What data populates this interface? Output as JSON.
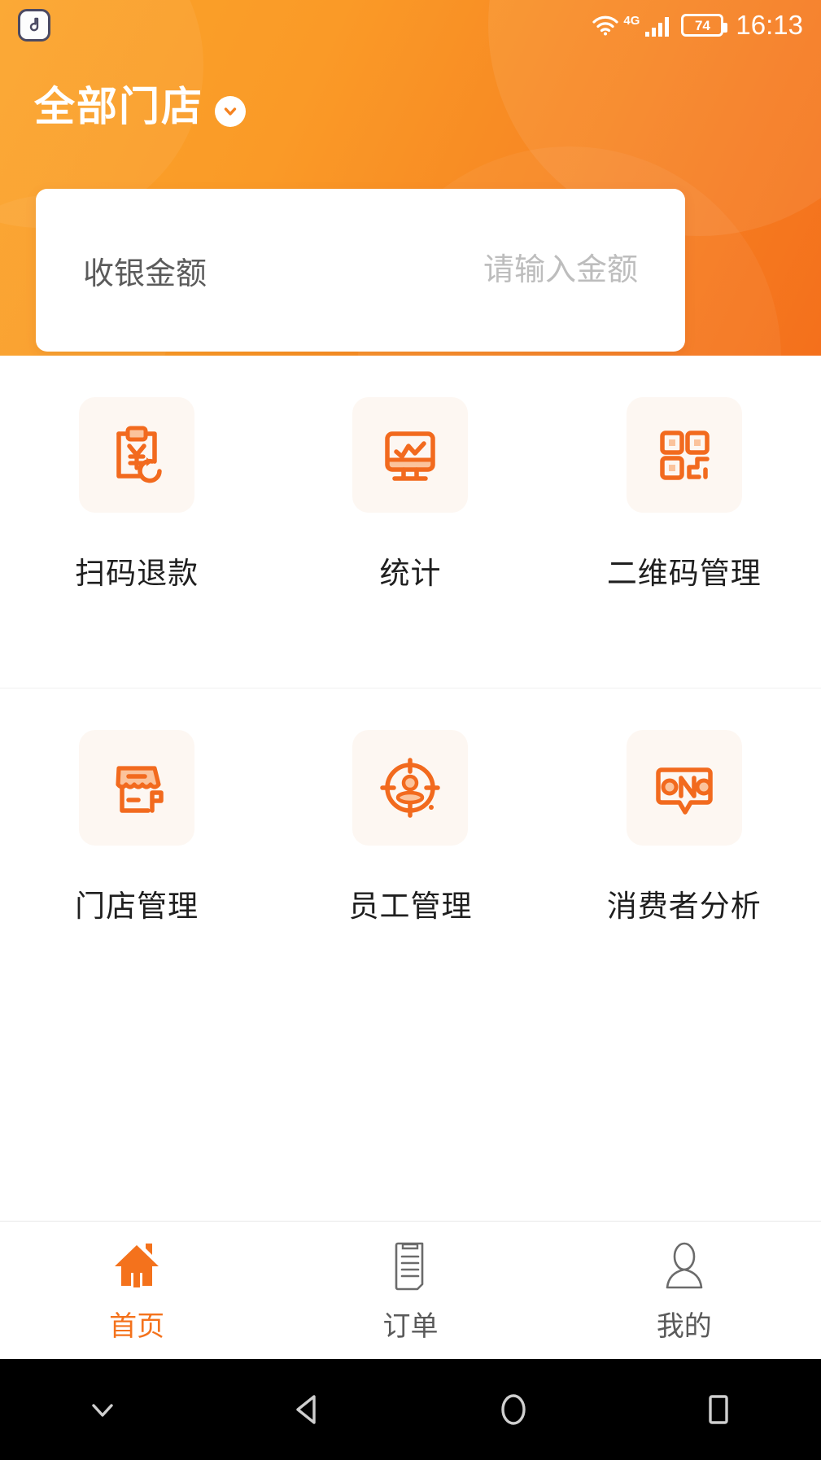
{
  "status_bar": {
    "app_icon": "app-logo-icon",
    "wifi_icon": "wifi-icon",
    "network_type": "4G",
    "signal_icon": "signal-bars-icon",
    "battery_level": "74",
    "time": "16:13"
  },
  "header": {
    "title": "全部门店",
    "dropdown_icon": "chevron-down-icon",
    "gradient_start": "#fba42a",
    "gradient_end": "#f4701c"
  },
  "amount_card": {
    "label": "收银金额",
    "placeholder": "请输入金额",
    "value": ""
  },
  "grid": {
    "rows": [
      {
        "items": [
          {
            "label": "扫码退款",
            "icon": "clipboard-yuan-refund-icon"
          },
          {
            "label": "统计",
            "icon": "monitor-chart-icon"
          },
          {
            "label": "二维码管理",
            "icon": "qr-code-icon"
          }
        ]
      },
      {
        "items": [
          {
            "label": "门店管理",
            "icon": "storefront-icon"
          },
          {
            "label": "员工管理",
            "icon": "target-person-icon"
          },
          {
            "label": "消费者分析",
            "icon": "speech-bubble-analysis-icon"
          }
        ]
      }
    ],
    "accent_color": "#f26a1e",
    "tile_background": "#fdf7f2"
  },
  "tab_bar": {
    "active_color": "#f4721c",
    "inactive_color": "#5a5a5a",
    "tabs": [
      {
        "label": "首页",
        "icon": "home-icon",
        "active": true
      },
      {
        "label": "订单",
        "icon": "receipt-icon",
        "active": false
      },
      {
        "label": "我的",
        "icon": "person-icon",
        "active": false
      }
    ]
  },
  "android_nav": {
    "buttons": [
      {
        "icon": "hide-keyboard-chevron-down-icon"
      },
      {
        "icon": "back-triangle-icon"
      },
      {
        "icon": "home-circle-icon"
      },
      {
        "icon": "recents-square-icon"
      }
    ]
  }
}
